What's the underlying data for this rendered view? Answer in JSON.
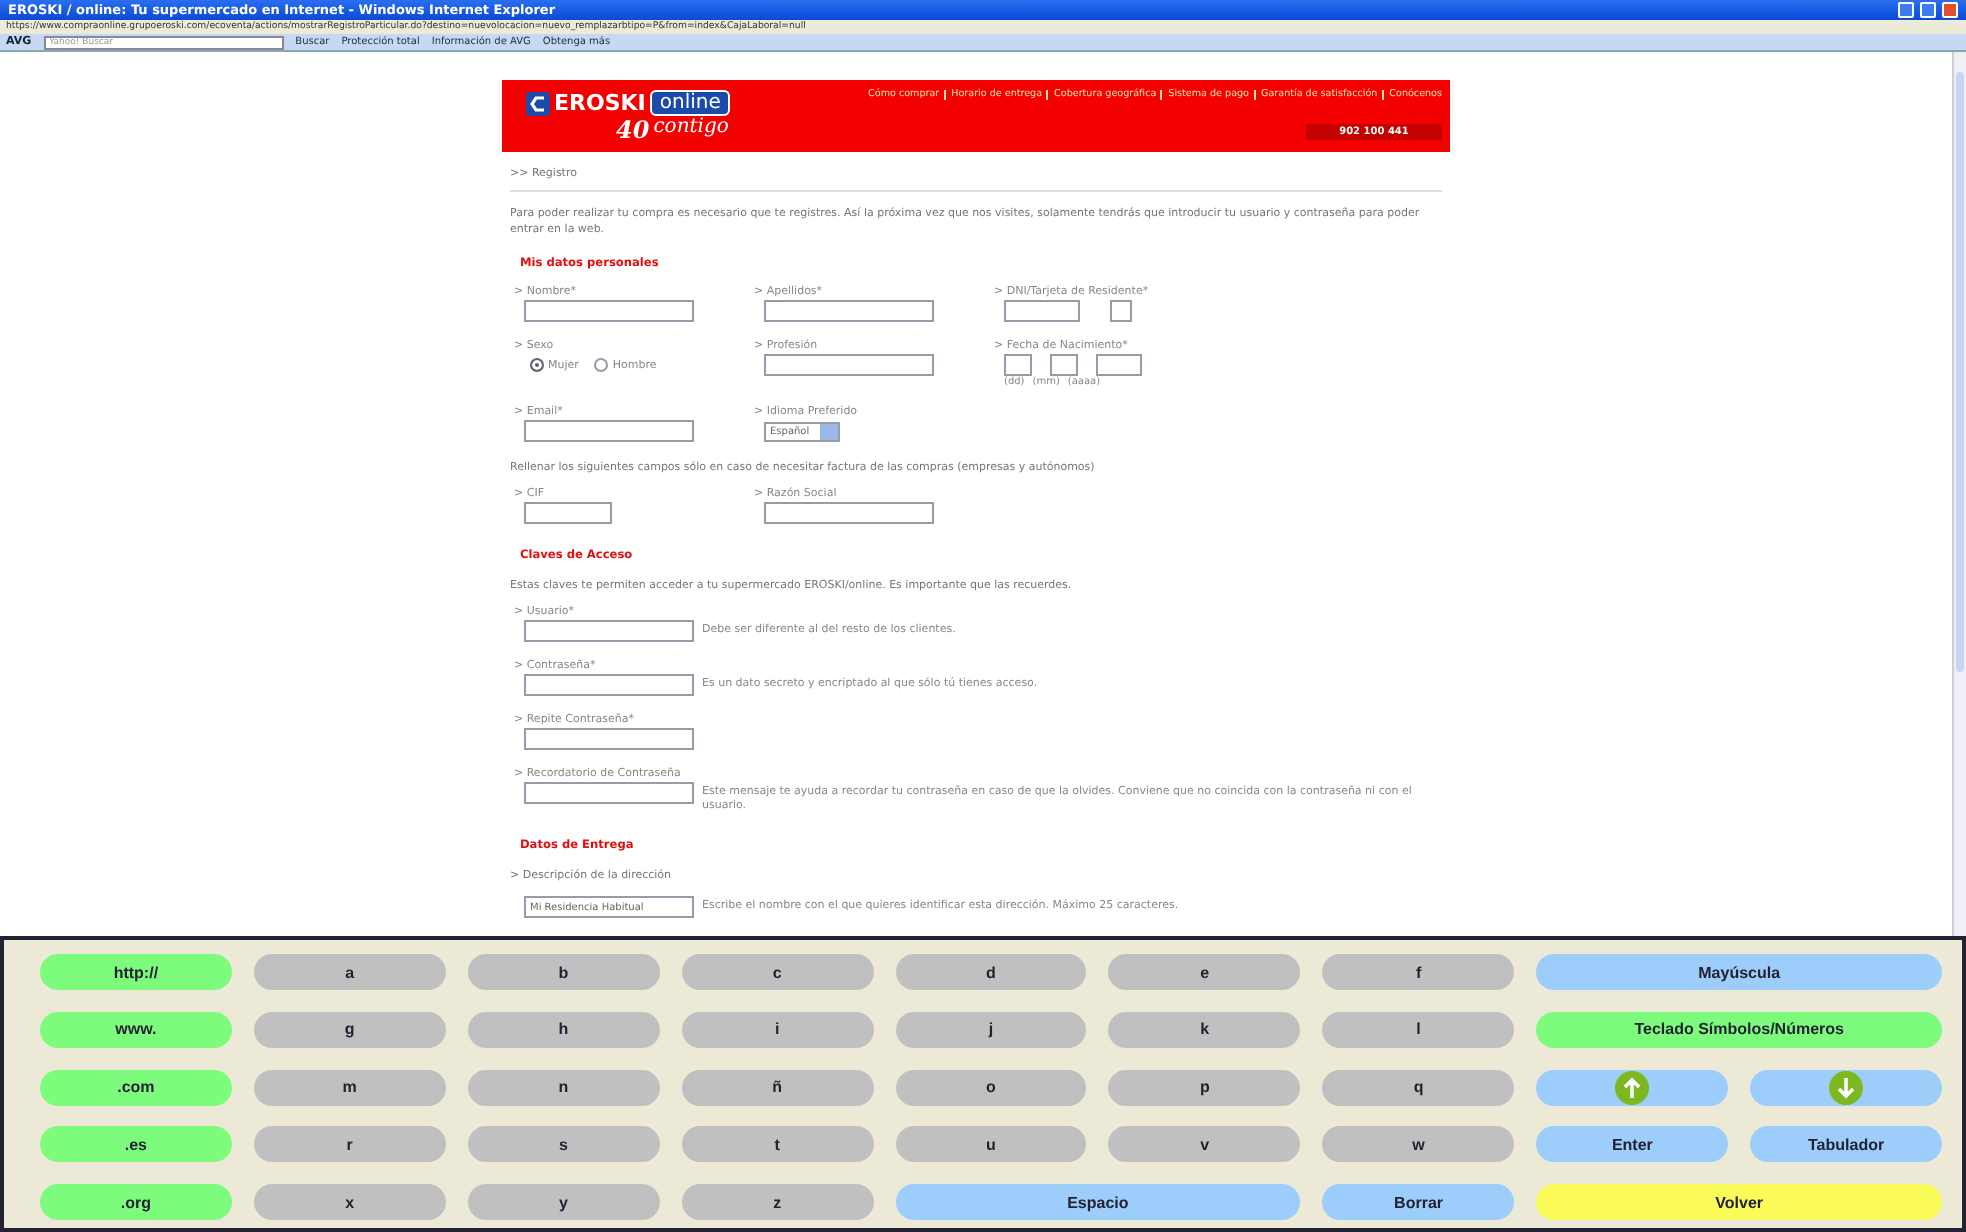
{
  "window": {
    "title": "EROSKI / online: Tu supermercado en Internet - Windows Internet Explorer",
    "address": "https://www.compraonline.grupoeroski.com/ecoventa/actions/mostrarRegistroParticular.do?destino=nuevolocacion=nuevo_remplazarbtipo=P&from=index&CajaLaboral=null"
  },
  "toolbar": {
    "brand": "AVG",
    "search_placeholder": "Yahoo! Buscar",
    "items": [
      "Buscar",
      "Protección total",
      "Información de AVG",
      "Obtenga más"
    ]
  },
  "header": {
    "logo": "EROSKI",
    "logo_suffix": "online",
    "tagline_number": "40",
    "tagline": "contigo",
    "nav": [
      "Cómo comprar",
      "Horario de entrega",
      "Cobertura geográfica",
      "Sistema de pago",
      "Garantía de satisfacción",
      "Conócenos"
    ],
    "phone": "902 100 441"
  },
  "breadcrumb": ">> Registro",
  "intro": "Para poder realizar tu compra es necesario que te registres. Así la próxima vez que nos visites, solamente tendrás que introducir tu usuario y contraseña para poder entrar en la web.",
  "sections": [
    {
      "title": "Mis datos personales",
      "rows": [
        {
          "kind": "fields",
          "fields": [
            {
              "kind": "text",
              "label": "> Nombre*"
            },
            {
              "kind": "text",
              "label": "> Apellidos*"
            },
            {
              "kind": "dni",
              "label": "> DNI/Tarjeta de Residente*"
            }
          ]
        },
        {
          "kind": "fields",
          "fields": [
            {
              "kind": "radio",
              "label": "> Sexo",
              "options": [
                {
                  "label": "Mujer",
                  "selected": true
                },
                {
                  "label": "Hombre",
                  "selected": false
                }
              ]
            },
            {
              "kind": "text",
              "label": "> Profesión"
            },
            {
              "kind": "date",
              "label": "> Fecha de Nacimiento*",
              "parts": [
                "(dd)",
                "(mm)",
                "(aaaa)"
              ]
            }
          ]
        },
        {
          "kind": "fields",
          "fields": [
            {
              "kind": "text",
              "label": "> Email*"
            },
            {
              "kind": "select",
              "label": "> Idioma Preferido",
              "value": "Español"
            }
          ]
        },
        {
          "kind": "note",
          "text": "Rellenar los siguientes campos sólo en caso de necesitar factura de las compras (empresas y autónomos)"
        },
        {
          "kind": "fields",
          "fields": [
            {
              "kind": "short",
              "label": "> CIF"
            },
            {
              "kind": "text",
              "label": "> Razón Social"
            }
          ]
        }
      ]
    },
    {
      "title": "Claves de Acceso",
      "rows": [
        {
          "kind": "note",
          "text": "Estas claves te permiten acceder a tu supermercado EROSKI/online. Es importante que las recuerdes."
        },
        {
          "kind": "fields",
          "fields": [
            {
              "kind": "text",
              "label": "> Usuario*",
              "help": "Debe ser diferente al del resto de los clientes."
            }
          ]
        },
        {
          "kind": "fields",
          "fields": [
            {
              "kind": "text",
              "label": "> Contraseña*",
              "help": "Es un dato secreto y encriptado al que sólo tú tienes acceso."
            }
          ]
        },
        {
          "kind": "fields",
          "fields": [
            {
              "kind": "text",
              "label": "> Repite Contraseña*"
            }
          ]
        },
        {
          "kind": "fields",
          "fields": [
            {
              "kind": "text",
              "label": "> Recordatorio de Contraseña",
              "help": "Este mensaje te ayuda a recordar tu contraseña en caso de que la olvides. Conviene que no coincida con la contraseña ni con el usuario."
            }
          ]
        }
      ]
    },
    {
      "title": "Datos de Entrega",
      "rows": [
        {
          "kind": "note",
          "text": "> Descripción de la dirección"
        },
        {
          "kind": "fields",
          "fields": [
            {
              "kind": "text",
              "value": "Mi Residencia Habitual",
              "help": "Escribe el nombre con el que quieres identificar esta dirección. Máximo 25 caracteres."
            }
          ]
        }
      ]
    }
  ],
  "keyboard": [
    {
      "kind": "text",
      "label": "http://",
      "color": "#7dfb7d"
    },
    {
      "kind": "text",
      "label": "a",
      "color": "#c0c0c0"
    },
    {
      "kind": "text",
      "label": "b",
      "color": "#c0c0c0"
    },
    {
      "kind": "text",
      "label": "c",
      "color": "#c0c0c0"
    },
    {
      "kind": "text",
      "label": "d",
      "color": "#c0c0c0"
    },
    {
      "kind": "text",
      "label": "e",
      "color": "#c0c0c0"
    },
    {
      "kind": "text",
      "label": "f",
      "color": "#c0c0c0"
    },
    {
      "kind": "wide",
      "label": "Mayúscula",
      "color": "#9ccdfb"
    },
    {
      "kind": "text",
      "label": "www.",
      "color": "#7dfb7d"
    },
    {
      "kind": "text",
      "label": "g",
      "color": "#c0c0c0"
    },
    {
      "kind": "text",
      "label": "h",
      "color": "#c0c0c0"
    },
    {
      "kind": "text",
      "label": "i",
      "color": "#c0c0c0"
    },
    {
      "kind": "text",
      "label": "j",
      "color": "#c0c0c0"
    },
    {
      "kind": "text",
      "label": "k",
      "color": "#c0c0c0"
    },
    {
      "kind": "text",
      "label": "l",
      "color": "#c0c0c0"
    },
    {
      "kind": "wide",
      "label": "Teclado Símbolos/Números",
      "color": "#7dfb7d"
    },
    {
      "kind": "text",
      "label": ".com",
      "color": "#7dfb7d"
    },
    {
      "kind": "text",
      "label": "m",
      "color": "#c0c0c0"
    },
    {
      "kind": "text",
      "label": "n",
      "color": "#c0c0c0"
    },
    {
      "kind": "text",
      "label": "ñ",
      "color": "#c0c0c0"
    },
    {
      "kind": "text",
      "label": "o",
      "color": "#c0c0c0"
    },
    {
      "kind": "text",
      "label": "p",
      "color": "#c0c0c0"
    },
    {
      "kind": "text",
      "label": "q",
      "color": "#c0c0c0"
    },
    {
      "kind": "up",
      "color": "#9ccdfb"
    },
    {
      "kind": "down",
      "color": "#9ccdfb"
    },
    {
      "kind": "text",
      "label": ".es",
      "color": "#7dfb7d"
    },
    {
      "kind": "text",
      "label": "r",
      "color": "#c0c0c0"
    },
    {
      "kind": "text",
      "label": "s",
      "color": "#c0c0c0"
    },
    {
      "kind": "text",
      "label": "t",
      "color": "#c0c0c0"
    },
    {
      "kind": "text",
      "label": "u",
      "color": "#c0c0c0"
    },
    {
      "kind": "text",
      "label": "v",
      "color": "#c0c0c0"
    },
    {
      "kind": "text",
      "label": "w",
      "color": "#c0c0c0"
    },
    {
      "kind": "text",
      "label": "Enter",
      "color": "#9ccdfb"
    },
    {
      "kind": "text",
      "label": "Tabulador",
      "color": "#9ccdfb"
    },
    {
      "kind": "text",
      "label": ".org",
      "color": "#7dfb7d"
    },
    {
      "kind": "text",
      "label": "x",
      "color": "#c0c0c0"
    },
    {
      "kind": "text",
      "label": "y",
      "color": "#c0c0c0"
    },
    {
      "kind": "text",
      "label": "z",
      "color": "#c0c0c0"
    },
    {
      "kind": "wide",
      "label": "Espacio",
      "color": "#9ccdfb"
    },
    {
      "kind": "text",
      "label": "Borrar",
      "color": "#9ccdfb"
    },
    {
      "kind": "wide",
      "label": "Volver",
      "color": "#fbfb5a"
    }
  ]
}
